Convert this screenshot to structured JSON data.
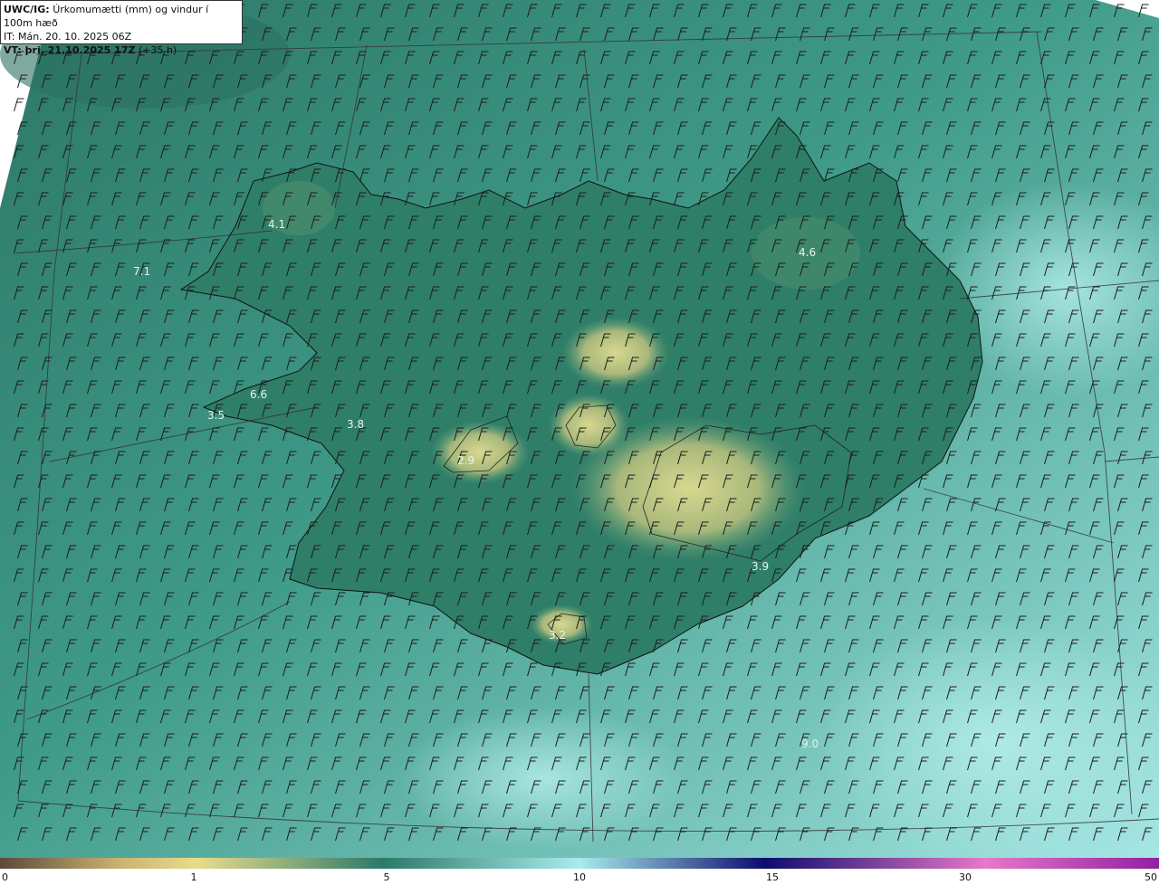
{
  "header": {
    "product": "UWC/IG:",
    "description": "Úrkomumætti (mm) og vindur í 100m hæð",
    "init_label": "IT:",
    "init_time": "Mán. 20. 10. 2025 06Z",
    "valid_label": "VT:",
    "valid_time": "þri. 21.10.2025 17Z",
    "lead": "(+35 h)"
  },
  "colorbar": {
    "ticks": [
      "0",
      "1",
      "5",
      "10",
      "15",
      "30",
      "50"
    ],
    "colors": [
      "#5a4a3c",
      "#c8b070",
      "#e8dc8c",
      "#2c7a6a",
      "#a8ecec",
      "#0c0c6c",
      "#e878c8",
      "#9020a0"
    ]
  },
  "labels": [
    {
      "text": "4.1"
    },
    {
      "text": "7.1"
    },
    {
      "text": "6.6"
    },
    {
      "text": "3.5"
    },
    {
      "text": "3.8"
    },
    {
      "text": "2.9"
    },
    {
      "text": "4.6"
    },
    {
      "text": "3.2"
    },
    {
      "text": "9.0"
    },
    {
      "text": "3.9"
    }
  ],
  "colors": {
    "sea": "#3e9a8a",
    "land_low": "#2f7a68",
    "land_high": "#c8c878",
    "coast": "#111111",
    "grid": "#444444",
    "barb": "#222222"
  }
}
